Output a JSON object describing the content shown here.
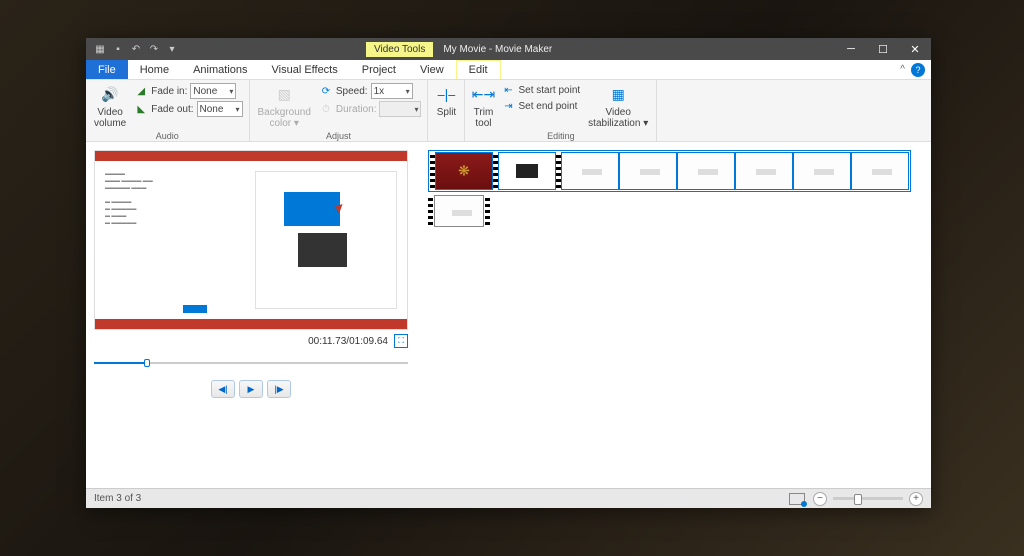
{
  "titlebar": {
    "tooltab": "Video Tools",
    "title": "My Movie - Movie Maker"
  },
  "tabs": {
    "file": "File",
    "home": "Home",
    "animations": "Animations",
    "visual_effects": "Visual Effects",
    "project": "Project",
    "view": "View",
    "edit": "Edit"
  },
  "ribbon": {
    "audio": {
      "video_volume": "Video\nvolume",
      "fade_in": "Fade in:",
      "fade_in_val": "None",
      "fade_out": "Fade out:",
      "fade_out_val": "None",
      "group": "Audio"
    },
    "adjust": {
      "bg_color": "Background\ncolor ▾",
      "speed": "Speed:",
      "speed_val": "1x",
      "duration": "Duration:",
      "duration_val": "",
      "group": "Adjust"
    },
    "split": "Split",
    "editing": {
      "trim_tool": "Trim\ntool",
      "set_start": "Set start point",
      "set_end": "Set end point",
      "stabilization": "Video\nstabilization ▾",
      "group": "Editing"
    }
  },
  "preview": {
    "time": "00:11.73/01:09.64"
  },
  "status": {
    "item": "Item 3 of 3"
  }
}
